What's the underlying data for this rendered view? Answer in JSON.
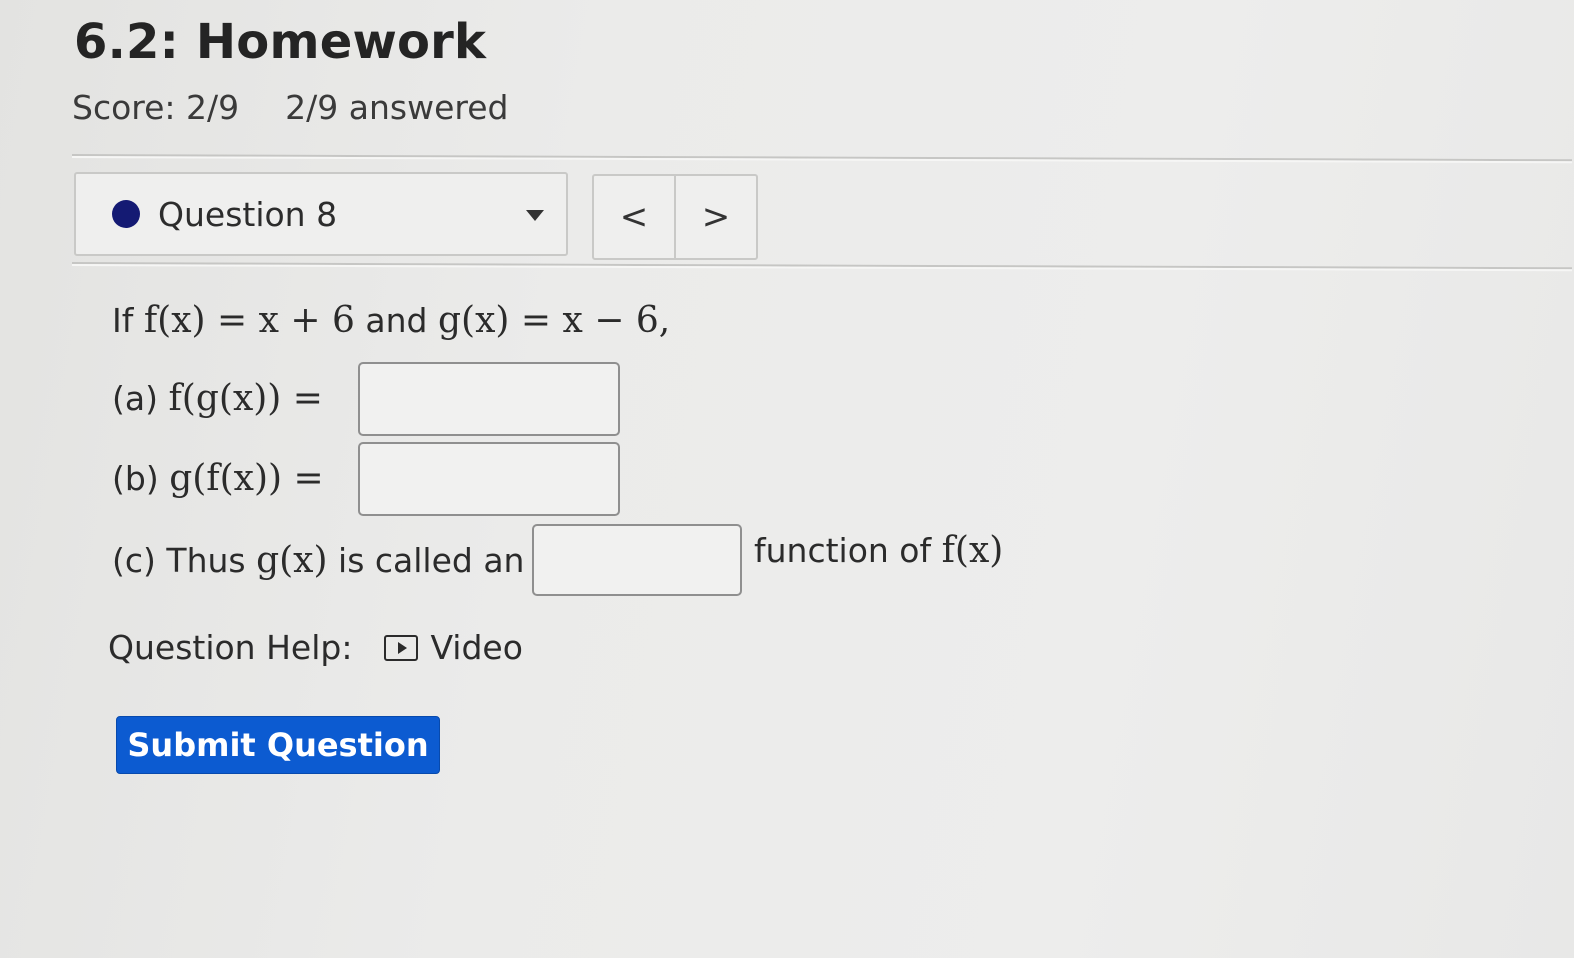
{
  "page": {
    "title": "6.2: Homework",
    "score": "Score: 2/9",
    "answered": "2/9 answered"
  },
  "question_nav": {
    "selected": "Question 8",
    "status_color": "#141a73",
    "prev_label": "<",
    "next_label": ">"
  },
  "problem": {
    "intro_prefix": "If",
    "intro_joiner": "and",
    "f_def": "f(x) = x + 6",
    "g_def": "g(x) = x − 6,",
    "part_a_label": "(a)",
    "part_a_expr": "f(g(x)) =",
    "part_a_value": "",
    "part_b_label": "(b)",
    "part_b_expr": "g(f(x)) =",
    "part_b_value": "",
    "part_c_label": "(c)",
    "part_c_thus": "Thus",
    "part_c_gx": "g(x)",
    "part_c_mid": "is called an",
    "part_c_value": "",
    "part_c_suffix": "function of",
    "part_c_fx": "f(x)"
  },
  "help": {
    "label": "Question Help:",
    "video_icon": "video-play-icon",
    "video_label": "Video"
  },
  "actions": {
    "submit_label": "Submit Question",
    "submit_color": "#0c5bd1"
  }
}
